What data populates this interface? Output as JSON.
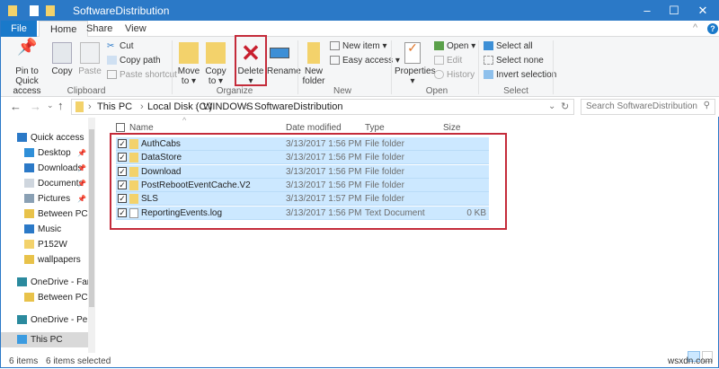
{
  "window": {
    "title": "SoftwareDistribution",
    "minimize": "–",
    "maximize": "☐",
    "close": "✕"
  },
  "tabs": [
    "File",
    "Home",
    "Share",
    "View"
  ],
  "ribbon": {
    "clipboard": {
      "pin": "Pin to Quick access",
      "copy": "Copy",
      "paste": "Paste",
      "cut": "Cut",
      "copy_path": "Copy path",
      "paste_shortcut": "Paste shortcut",
      "label": "Clipboard"
    },
    "organize": {
      "move_to": "Move to",
      "copy_to": "Copy to",
      "delete": "Delete",
      "rename": "Rename",
      "label": "Organize"
    },
    "new": {
      "new_folder": "New folder",
      "new_item": "New item ▾",
      "easy_access": "Easy access ▾",
      "label": "New"
    },
    "open": {
      "properties": "Properties",
      "open": "Open ▾",
      "edit": "Edit",
      "history": "History",
      "label": "Open"
    },
    "select": {
      "select_all": "Select all",
      "select_none": "Select none",
      "invert": "Invert selection",
      "label": "Select"
    }
  },
  "address": {
    "crumbs": [
      "This PC",
      "Local Disk (C:)",
      "WINDOWS",
      "SoftwareDistribution"
    ],
    "search_placeholder": "Search SoftwareDistribution"
  },
  "nav": [
    {
      "label": "Quick access",
      "color": "#2b79c7"
    },
    {
      "label": "Desktop",
      "color": "#2f8fd8",
      "pin": true
    },
    {
      "label": "Downloads",
      "color": "#2b79c7",
      "pin": true
    },
    {
      "label": "Documents",
      "color": "#cfd6de",
      "pin": true
    },
    {
      "label": "Pictures",
      "color": "#8aa0b4",
      "pin": true
    },
    {
      "label": "Between PCs",
      "color": "#e8c24a"
    },
    {
      "label": "Music",
      "color": "#2b79c7"
    },
    {
      "label": "P152W",
      "color": "#f3d26b"
    },
    {
      "label": "wallpapers",
      "color": "#e8c24a"
    },
    {
      "label": "OneDrive - Family",
      "color": "#2b8a9e"
    },
    {
      "label": "Between PCs",
      "color": "#e8c24a"
    },
    {
      "label": "OneDrive - Persor",
      "color": "#2b8a9e"
    },
    {
      "label": "This PC",
      "color": "#3b9be0",
      "selected": true
    }
  ],
  "columns": {
    "name": "Name",
    "date": "Date modified",
    "type": "Type",
    "size": "Size"
  },
  "files": [
    {
      "name": "AuthCabs",
      "date": "3/13/2017 1:56 PM",
      "type": "File folder",
      "size": ""
    },
    {
      "name": "DataStore",
      "date": "3/13/2017 1:56 PM",
      "type": "File folder",
      "size": ""
    },
    {
      "name": "Download",
      "date": "3/13/2017 1:56 PM",
      "type": "File folder",
      "size": ""
    },
    {
      "name": "PostRebootEventCache.V2",
      "date": "3/13/2017 1:56 PM",
      "type": "File folder",
      "size": ""
    },
    {
      "name": "SLS",
      "date": "3/13/2017 1:57 PM",
      "type": "File folder",
      "size": ""
    },
    {
      "name": "ReportingEvents.log",
      "date": "3/13/2017 1:56 PM",
      "type": "Text Document",
      "size": "0 KB"
    }
  ],
  "status": {
    "items": "6 items",
    "selected": "6 items selected"
  },
  "watermark": "wsxdn.com"
}
